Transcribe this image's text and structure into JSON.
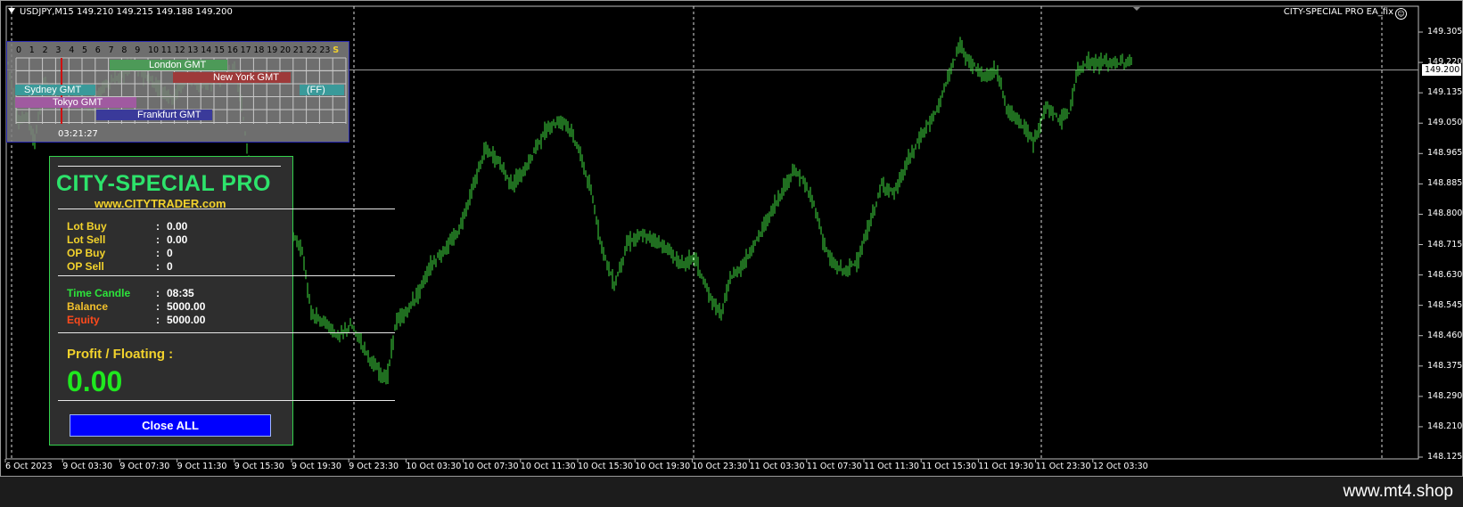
{
  "chart": {
    "symbol_line": "USDJPY,M15  149.210 149.215 149.188 149.200",
    "ea_name": "CITY-SPECIAL PRO EA_fix",
    "ea_smiley": "☺",
    "current_price": "149.200",
    "price_labels": [
      "149.305",
      "149.220",
      "149.135",
      "149.050",
      "148.965",
      "148.885",
      "148.800",
      "148.715",
      "148.630",
      "148.545",
      "148.460",
      "148.375",
      "148.290",
      "148.210",
      "148.125"
    ],
    "time_labels": [
      "6 Oct 2023",
      "9 Oct 03:30",
      "9 Oct 07:30",
      "9 Oct 11:30",
      "9 Oct 15:30",
      "9 Oct 19:30",
      "9 Oct 23:30",
      "10 Oct 03:30",
      "10 Oct 07:30",
      "10 Oct 11:30",
      "10 Oct 15:30",
      "10 Oct 19:30",
      "10 Oct 23:30",
      "11 Oct 03:30",
      "11 Oct 07:30",
      "11 Oct 11:30",
      "11 Oct 15:30",
      "11 Oct 19:30",
      "11 Oct 23:30",
      "12 Oct 03:30"
    ],
    "candle_color": "#3fdc3f",
    "ohlc_path": [
      [
        0,
        149.22
      ],
      [
        12,
        149.05
      ],
      [
        20,
        149.08
      ],
      [
        30,
        149.0
      ],
      [
        40,
        149.17
      ],
      [
        55,
        149.12
      ],
      [
        70,
        149.15
      ],
      [
        90,
        149.1
      ],
      [
        110,
        149.16
      ],
      [
        125,
        149.18
      ],
      [
        140,
        149.22
      ],
      [
        155,
        149.18
      ],
      [
        170,
        149.15
      ],
      [
        185,
        149.12
      ],
      [
        200,
        149.18
      ],
      [
        215,
        149.16
      ],
      [
        230,
        149.17
      ],
      [
        245,
        149.19
      ],
      [
        255,
        149.2
      ],
      [
        262,
        149.1
      ],
      [
        270,
        148.95
      ],
      [
        280,
        148.7
      ],
      [
        290,
        148.55
      ],
      [
        300,
        148.62
      ],
      [
        310,
        148.72
      ],
      [
        320,
        148.74
      ],
      [
        330,
        148.7
      ],
      [
        340,
        148.52
      ],
      [
        355,
        148.5
      ],
      [
        370,
        148.46
      ],
      [
        385,
        148.49
      ],
      [
        395,
        148.45
      ],
      [
        410,
        148.38
      ],
      [
        425,
        148.34
      ],
      [
        435,
        148.5
      ],
      [
        445,
        148.52
      ],
      [
        460,
        148.58
      ],
      [
        475,
        148.66
      ],
      [
        490,
        148.7
      ],
      [
        505,
        148.75
      ],
      [
        520,
        148.86
      ],
      [
        535,
        148.98
      ],
      [
        550,
        148.95
      ],
      [
        565,
        148.88
      ],
      [
        580,
        148.92
      ],
      [
        595,
        149.0
      ],
      [
        610,
        149.05
      ],
      [
        625,
        149.06
      ],
      [
        640,
        148.98
      ],
      [
        655,
        148.85
      ],
      [
        665,
        148.72
      ],
      [
        680,
        148.6
      ],
      [
        695,
        148.72
      ],
      [
        710,
        148.74
      ],
      [
        725,
        148.73
      ],
      [
        740,
        148.7
      ],
      [
        755,
        148.66
      ],
      [
        770,
        148.68
      ],
      [
        785,
        148.58
      ],
      [
        800,
        148.52
      ],
      [
        810,
        148.62
      ],
      [
        825,
        148.66
      ],
      [
        840,
        148.73
      ],
      [
        855,
        148.8
      ],
      [
        870,
        148.87
      ],
      [
        880,
        148.92
      ],
      [
        890,
        148.9
      ],
      [
        905,
        148.82
      ],
      [
        915,
        148.72
      ],
      [
        925,
        148.66
      ],
      [
        940,
        148.64
      ],
      [
        955,
        148.68
      ],
      [
        965,
        148.76
      ],
      [
        980,
        148.88
      ],
      [
        995,
        148.86
      ],
      [
        1010,
        148.95
      ],
      [
        1025,
        149.02
      ],
      [
        1040,
        149.08
      ],
      [
        1055,
        149.18
      ],
      [
        1068,
        149.27
      ],
      [
        1080,
        149.22
      ],
      [
        1095,
        149.18
      ],
      [
        1110,
        149.2
      ],
      [
        1120,
        149.09
      ],
      [
        1135,
        149.06
      ],
      [
        1150,
        149.0
      ],
      [
        1165,
        149.1
      ],
      [
        1180,
        149.06
      ],
      [
        1190,
        149.08
      ],
      [
        1200,
        149.2
      ],
      [
        1210,
        149.22
      ]
    ]
  },
  "sessions": {
    "hours": [
      "0",
      "1",
      "2",
      "3",
      "4",
      "5",
      "6",
      "7",
      "8",
      "9",
      "10",
      "11",
      "12",
      "13",
      "14",
      "15",
      "16",
      "17",
      "18",
      "19",
      "20",
      "21",
      "22",
      "23",
      "S"
    ],
    "bars": [
      {
        "label": "London GMT",
        "color": "#4d9a58"
      },
      {
        "label": "New York GMT",
        "color": "#9e3a3a"
      },
      {
        "label": "Sydney GMT",
        "color": "#3a9a9a"
      },
      {
        "label": "(FF)",
        "color": "#3a9a9a"
      },
      {
        "label": "Tokyo GMT",
        "color": "#a05aa0"
      },
      {
        "label": "Frankfurt GMT",
        "color": "#3a3a9a"
      }
    ],
    "timer": "03:21:27"
  },
  "panel": {
    "title": "CITY-SPECIAL PRO",
    "url": "www.CITYTRADER.com",
    "rows": [
      {
        "key": "Lot Buy",
        "colon": ":",
        "value": "0.00",
        "color": "#f2d22c"
      },
      {
        "key": "Lot Sell",
        "colon": ":",
        "value": "0.00",
        "color": "#f2d22c"
      },
      {
        "key": "OP Buy",
        "colon": ":",
        "value": "0",
        "color": "#f2d22c"
      },
      {
        "key": "OP Sell",
        "colon": ":",
        "value": "0",
        "color": "#f2d22c"
      },
      {
        "key": "Time Candle",
        "colon": ":",
        "value": "08:35",
        "color": "#2de33b"
      },
      {
        "key": "Balance",
        "colon": ":",
        "value": "5000.00",
        "color": "#f2c02c"
      },
      {
        "key": "Equity",
        "colon": ":",
        "value": "5000.00",
        "color": "#ff4a1c"
      }
    ],
    "profit_label": "Profit / Floating  :",
    "profit_value": "0.00",
    "close_button": "Close ALL"
  },
  "watermark": "www.mt4.shop"
}
